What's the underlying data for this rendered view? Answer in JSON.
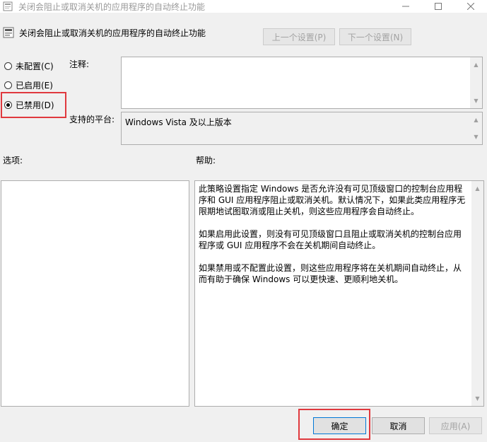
{
  "window": {
    "title": "关闭会阻止或取消关机的应用程序的自动终止功能"
  },
  "header": {
    "policy_name": "关闭会阻止或取消关机的应用程序的自动终止功能",
    "prev_setting": "上一个设置(P)",
    "next_setting": "下一个设置(N)"
  },
  "state": {
    "options": [
      {
        "label": "未配置(C)",
        "checked": false
      },
      {
        "label": "已启用(E)",
        "checked": false
      },
      {
        "label": "已禁用(D)",
        "checked": true
      }
    ]
  },
  "comment": {
    "label": "注释:",
    "value": ""
  },
  "platform": {
    "label": "支持的平台:",
    "value": "Windows Vista 及以上版本"
  },
  "options_panel": {
    "label": "选项:"
  },
  "help_panel": {
    "label": "帮助:",
    "paragraphs": [
      "此策略设置指定 Windows 是否允许没有可见顶级窗口的控制台应用程序和 GUI 应用程序阻止或取消关机。默认情况下，如果此类应用程序无限期地试图取消或阻止关机，则这些应用程序会自动终止。",
      "如果启用此设置，则没有可见顶级窗口且阻止或取消关机的控制台应用程序或 GUI 应用程序不会在关机期间自动终止。",
      "如果禁用或不配置此设置，则这些应用程序将在关机期间自动终止，从而有助于确保 Windows 可以更快速、更顺利地关机。"
    ]
  },
  "footer": {
    "ok": "确定",
    "cancel": "取消",
    "apply": "应用(A)"
  },
  "colors": {
    "highlight": "#e0393e",
    "primary_border": "#0078d7"
  }
}
